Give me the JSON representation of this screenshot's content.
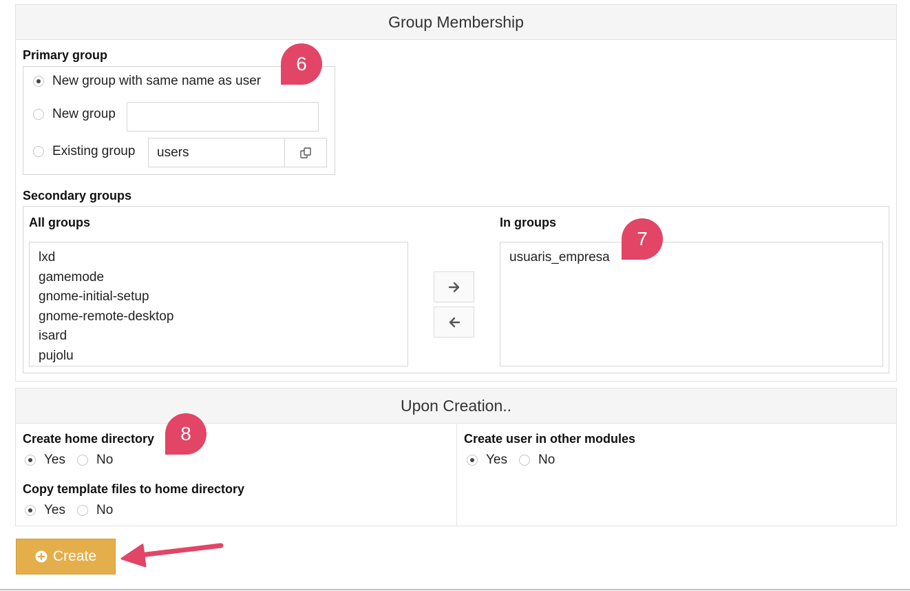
{
  "group_membership": {
    "title": "Group Membership",
    "primary": {
      "label": "Primary group",
      "opt_same_name": "New group with same name as user",
      "opt_new_group": "New group",
      "opt_existing": "Existing group",
      "existing_value": "users"
    },
    "secondary": {
      "label": "Secondary groups",
      "all_groups_label": "All groups",
      "in_groups_label": "In groups",
      "all_groups": [
        "lxd",
        "gamemode",
        "gnome-initial-setup",
        "gnome-remote-desktop",
        "isard",
        "pujolu"
      ],
      "in_groups": [
        "usuaris_empresa"
      ]
    }
  },
  "upon_creation": {
    "title": "Upon Creation..",
    "home_dir_label": "Create home directory",
    "copy_template_label": "Copy template files to home directory",
    "other_modules_label": "Create user in other modules",
    "yes": "Yes",
    "no": "No"
  },
  "create_button": "Create",
  "badges": [
    "6",
    "7",
    "8"
  ],
  "colors": {
    "badge": "#e24566",
    "button": "#e4ae4a",
    "arrow": "#e24566"
  }
}
